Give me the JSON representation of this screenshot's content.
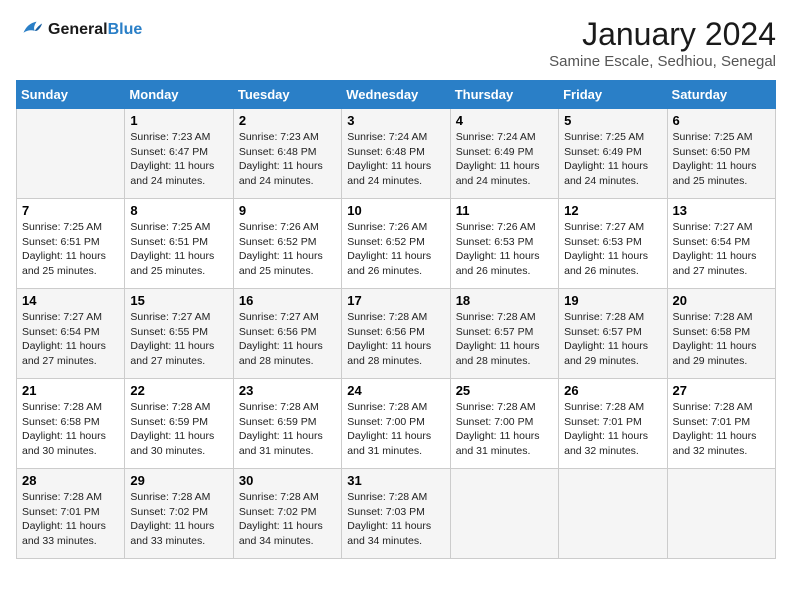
{
  "header": {
    "logo_line1": "General",
    "logo_line2": "Blue",
    "month_title": "January 2024",
    "location": "Samine Escale, Sedhiou, Senegal"
  },
  "days_of_week": [
    "Sunday",
    "Monday",
    "Tuesday",
    "Wednesday",
    "Thursday",
    "Friday",
    "Saturday"
  ],
  "weeks": [
    [
      {
        "num": "",
        "info": ""
      },
      {
        "num": "1",
        "info": "Sunrise: 7:23 AM\nSunset: 6:47 PM\nDaylight: 11 hours and 24 minutes."
      },
      {
        "num": "2",
        "info": "Sunrise: 7:23 AM\nSunset: 6:48 PM\nDaylight: 11 hours and 24 minutes."
      },
      {
        "num": "3",
        "info": "Sunrise: 7:24 AM\nSunset: 6:48 PM\nDaylight: 11 hours and 24 minutes."
      },
      {
        "num": "4",
        "info": "Sunrise: 7:24 AM\nSunset: 6:49 PM\nDaylight: 11 hours and 24 minutes."
      },
      {
        "num": "5",
        "info": "Sunrise: 7:25 AM\nSunset: 6:49 PM\nDaylight: 11 hours and 24 minutes."
      },
      {
        "num": "6",
        "info": "Sunrise: 7:25 AM\nSunset: 6:50 PM\nDaylight: 11 hours and 25 minutes."
      }
    ],
    [
      {
        "num": "7",
        "info": "Sunrise: 7:25 AM\nSunset: 6:51 PM\nDaylight: 11 hours and 25 minutes."
      },
      {
        "num": "8",
        "info": "Sunrise: 7:25 AM\nSunset: 6:51 PM\nDaylight: 11 hours and 25 minutes."
      },
      {
        "num": "9",
        "info": "Sunrise: 7:26 AM\nSunset: 6:52 PM\nDaylight: 11 hours and 25 minutes."
      },
      {
        "num": "10",
        "info": "Sunrise: 7:26 AM\nSunset: 6:52 PM\nDaylight: 11 hours and 26 minutes."
      },
      {
        "num": "11",
        "info": "Sunrise: 7:26 AM\nSunset: 6:53 PM\nDaylight: 11 hours and 26 minutes."
      },
      {
        "num": "12",
        "info": "Sunrise: 7:27 AM\nSunset: 6:53 PM\nDaylight: 11 hours and 26 minutes."
      },
      {
        "num": "13",
        "info": "Sunrise: 7:27 AM\nSunset: 6:54 PM\nDaylight: 11 hours and 27 minutes."
      }
    ],
    [
      {
        "num": "14",
        "info": "Sunrise: 7:27 AM\nSunset: 6:54 PM\nDaylight: 11 hours and 27 minutes."
      },
      {
        "num": "15",
        "info": "Sunrise: 7:27 AM\nSunset: 6:55 PM\nDaylight: 11 hours and 27 minutes."
      },
      {
        "num": "16",
        "info": "Sunrise: 7:27 AM\nSunset: 6:56 PM\nDaylight: 11 hours and 28 minutes."
      },
      {
        "num": "17",
        "info": "Sunrise: 7:28 AM\nSunset: 6:56 PM\nDaylight: 11 hours and 28 minutes."
      },
      {
        "num": "18",
        "info": "Sunrise: 7:28 AM\nSunset: 6:57 PM\nDaylight: 11 hours and 28 minutes."
      },
      {
        "num": "19",
        "info": "Sunrise: 7:28 AM\nSunset: 6:57 PM\nDaylight: 11 hours and 29 minutes."
      },
      {
        "num": "20",
        "info": "Sunrise: 7:28 AM\nSunset: 6:58 PM\nDaylight: 11 hours and 29 minutes."
      }
    ],
    [
      {
        "num": "21",
        "info": "Sunrise: 7:28 AM\nSunset: 6:58 PM\nDaylight: 11 hours and 30 minutes."
      },
      {
        "num": "22",
        "info": "Sunrise: 7:28 AM\nSunset: 6:59 PM\nDaylight: 11 hours and 30 minutes."
      },
      {
        "num": "23",
        "info": "Sunrise: 7:28 AM\nSunset: 6:59 PM\nDaylight: 11 hours and 31 minutes."
      },
      {
        "num": "24",
        "info": "Sunrise: 7:28 AM\nSunset: 7:00 PM\nDaylight: 11 hours and 31 minutes."
      },
      {
        "num": "25",
        "info": "Sunrise: 7:28 AM\nSunset: 7:00 PM\nDaylight: 11 hours and 31 minutes."
      },
      {
        "num": "26",
        "info": "Sunrise: 7:28 AM\nSunset: 7:01 PM\nDaylight: 11 hours and 32 minutes."
      },
      {
        "num": "27",
        "info": "Sunrise: 7:28 AM\nSunset: 7:01 PM\nDaylight: 11 hours and 32 minutes."
      }
    ],
    [
      {
        "num": "28",
        "info": "Sunrise: 7:28 AM\nSunset: 7:01 PM\nDaylight: 11 hours and 33 minutes."
      },
      {
        "num": "29",
        "info": "Sunrise: 7:28 AM\nSunset: 7:02 PM\nDaylight: 11 hours and 33 minutes."
      },
      {
        "num": "30",
        "info": "Sunrise: 7:28 AM\nSunset: 7:02 PM\nDaylight: 11 hours and 34 minutes."
      },
      {
        "num": "31",
        "info": "Sunrise: 7:28 AM\nSunset: 7:03 PM\nDaylight: 11 hours and 34 minutes."
      },
      {
        "num": "",
        "info": ""
      },
      {
        "num": "",
        "info": ""
      },
      {
        "num": "",
        "info": ""
      }
    ]
  ]
}
